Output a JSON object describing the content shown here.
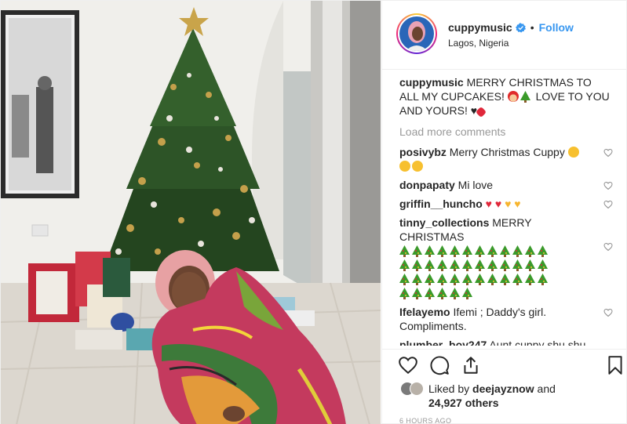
{
  "post": {
    "username": "cuppymusic",
    "follow_label": "Follow",
    "location": "Lagos, Nigeria",
    "caption": {
      "username": "cuppymusic",
      "text_1": "MERRY CHRISTMAS TO ALL MY CUPCAKES!",
      "text_2": "LOVE TO YOU AND YOURS!"
    },
    "load_more": "Load more comments",
    "comments": [
      {
        "username": "posivybz",
        "text": "Merry Christmas Cuppy"
      },
      {
        "username": "donpapaty",
        "text": "Mi love"
      },
      {
        "username": "griffin__huncho",
        "text": ""
      },
      {
        "username": "tinny_collections",
        "text": "MERRY CHRISTMAS"
      },
      {
        "username": "Ifelayemo",
        "text": "Ifemi ; Daddy's girl. Compliments."
      },
      {
        "username": "plumber_boy247",
        "text": "Aunt cuppy shu shu ........ Shu should I send my"
      }
    ],
    "likes": {
      "prefix": "Liked by",
      "user": "deejayznow",
      "and": "and",
      "count": "24,927 others"
    },
    "timestamp": "6 HOURS AGO"
  },
  "icons": {
    "heart": "heart-icon",
    "comment": "comment-icon",
    "share": "share-icon",
    "save": "bookmark-icon",
    "verified": "verified-badge-icon"
  },
  "colors": {
    "link_blue": "#3897f0",
    "muted": "#999999",
    "text": "#262626"
  }
}
